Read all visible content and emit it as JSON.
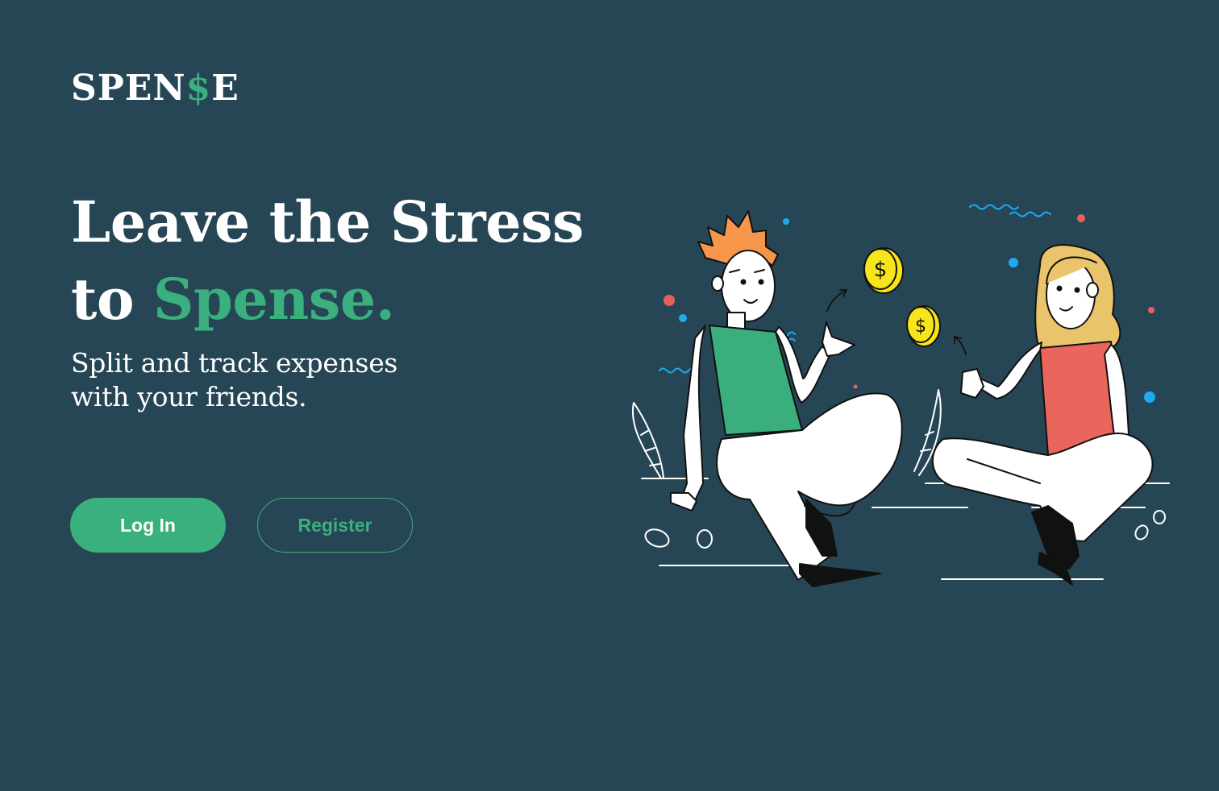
{
  "brand": {
    "logo_prefix": "SPEN",
    "logo_accent": "$",
    "logo_suffix": "E"
  },
  "hero": {
    "headline_line1": "Leave the Stress",
    "headline_line2_prefix": "to ",
    "headline_line2_accent": "Spense.",
    "subtitle": "Split and track expenses with your friends."
  },
  "actions": {
    "login_label": "Log In",
    "register_label": "Register"
  },
  "illustration": {
    "description_icon": "two-friends-exchanging-coins-illustration",
    "coin_symbol": "$"
  },
  "colors": {
    "background": "#274655",
    "accent": "#3bb07f",
    "text": "#ffffff",
    "coin": "#f5e51a",
    "shirt_green": "#3aaf7d",
    "shirt_red": "#ea665c",
    "hair_orange": "#f6964a",
    "hair_blonde": "#e9c46a",
    "dot_blue": "#1eaaf1",
    "dot_red": "#e9605a"
  }
}
